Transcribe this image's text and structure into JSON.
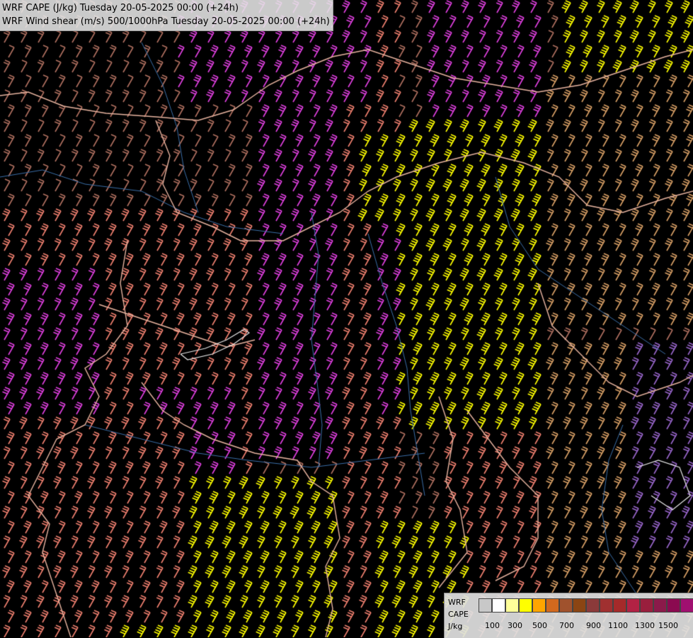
{
  "header": {
    "line1": "WRF CAPE (J/kg) Tuesday 20-05-2025 00:00 (+24h)",
    "line2": "WRF Wind shear (m/s) 500/1000hPa Tuesday 20-05-2025 00:00 (+24h)"
  },
  "legend": {
    "label_model": "WRF",
    "label_field": "CAPE",
    "label_unit": "J/kg",
    "colors": [
      "#c8c8c8",
      "#ffffff",
      "#ffff99",
      "#ffff00",
      "#ffa500",
      "#d2691e",
      "#a0522d",
      "#8b4513",
      "#8b3a3a",
      "#a03030",
      "#a52a2a",
      "#b22244",
      "#991f3d",
      "#8b1a4a",
      "#8b0a50",
      "#a01070"
    ],
    "ticks": [
      "100",
      "300",
      "500",
      "700",
      "900",
      "1100",
      "1300",
      "1500"
    ]
  },
  "map": {
    "background": "#000000",
    "border_color": "#e8b4a0",
    "river_color": "#3a6ea8",
    "coast_color": "#e8e8e8",
    "barb_colors": {
      "weak": "#b07060",
      "salmon": "#f08070",
      "magenta": "#e040e0",
      "yellow": "#ffff00",
      "tan": "#d9a066",
      "violet": "#9966cc"
    }
  }
}
